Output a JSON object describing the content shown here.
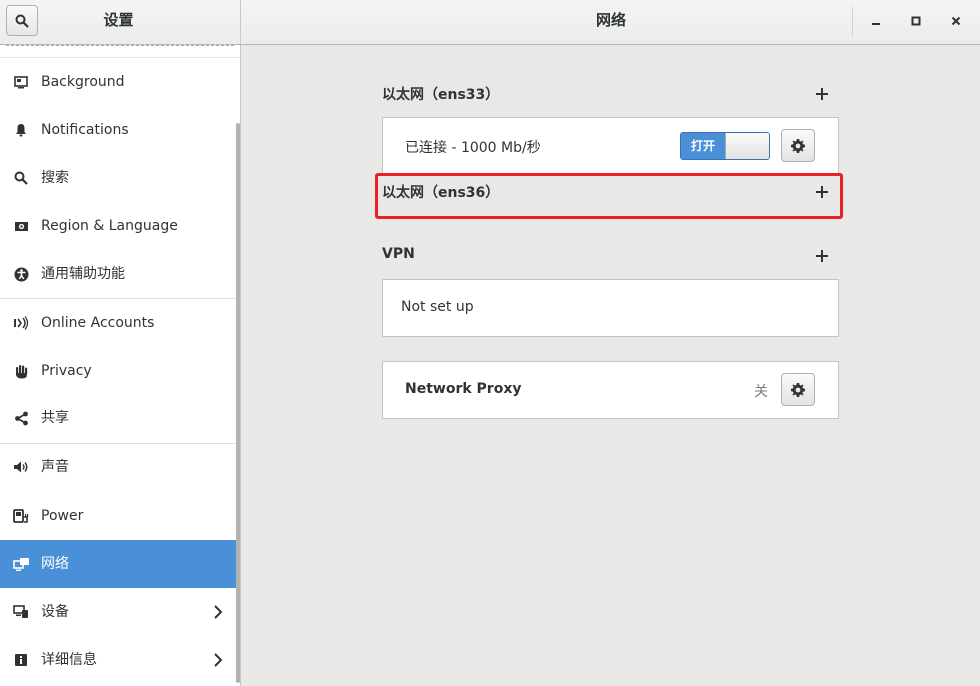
{
  "header": {
    "left_title": "设置",
    "center_title": "网络",
    "search_icon": "search-icon",
    "controls": [
      "minimize-icon",
      "maximize-icon",
      "close-icon"
    ]
  },
  "sidebar": {
    "items": [
      {
        "label": "Background",
        "icon": "background-icon"
      },
      {
        "label": "Notifications",
        "icon": "bell-icon"
      },
      {
        "label": "搜索",
        "icon": "search-icon"
      },
      {
        "label": "Region & Language",
        "icon": "region-icon"
      },
      {
        "label": "通用辅助功能",
        "icon": "accessibility-icon"
      },
      {
        "label": "Online Accounts",
        "icon": "online-accounts-icon"
      },
      {
        "label": "Privacy",
        "icon": "hand-icon"
      },
      {
        "label": "共享",
        "icon": "share-icon"
      },
      {
        "label": "声音",
        "icon": "speaker-icon"
      },
      {
        "label": "Power",
        "icon": "power-icon"
      },
      {
        "label": "网络",
        "icon": "network-icon",
        "active": true
      },
      {
        "label": "设备",
        "icon": "devices-icon",
        "chevron": true
      },
      {
        "label": "详细信息",
        "icon": "info-icon",
        "chevron": true
      }
    ]
  },
  "main": {
    "ethernet1": {
      "title": "以太网（ens33）",
      "status": "已连接 - 1000 Mb/秒",
      "switch_label": "打开"
    },
    "ethernet2": {
      "title": "以太网（ens36）"
    },
    "vpn": {
      "title": "VPN",
      "status": "Not set up"
    },
    "proxy": {
      "title": "Network Proxy",
      "state": "关"
    }
  },
  "colors": {
    "accent": "#4a90d9",
    "highlight": "#e8202a"
  }
}
